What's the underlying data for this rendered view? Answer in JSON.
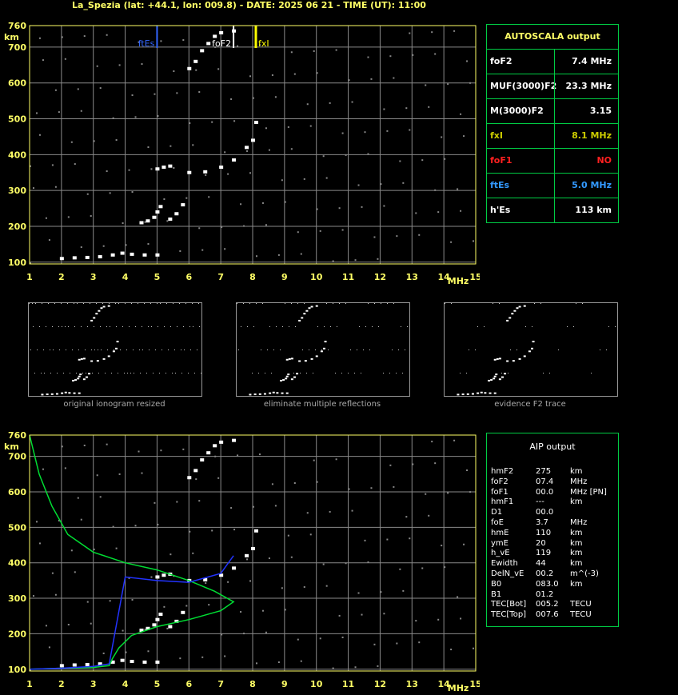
{
  "title": "La_Spezia (lat: +44.1, lon: 009.8) - DATE: 2025 06 21 - TIME (UT): 11:00",
  "colors": {
    "grid": "#8a8a8a",
    "axis": "#ffff66",
    "border": "#00cc44",
    "fxI": "#ffff00",
    "ftEs": "#3366ff",
    "foF1": "#ff2020",
    "profile": "#00dd33",
    "trace": "#2233ff"
  },
  "axes": {
    "y_unit": "km",
    "x_unit": "MHz",
    "y_ticks": [
      "760",
      "700",
      "600",
      "500",
      "400",
      "300",
      "200",
      "100"
    ],
    "x_ticks": [
      "1",
      "2",
      "3",
      "4",
      "5",
      "6",
      "7",
      "8",
      "9",
      "10",
      "11",
      "12",
      "13",
      "14",
      "15"
    ]
  },
  "markers": {
    "ftEs_label": "ftEs",
    "foF2_label": "foF2",
    "fxI_label": "fxI"
  },
  "autoscala": {
    "header": "AUTOSCALA output",
    "rows": [
      {
        "key": "foF2",
        "value": "7.4 MHz",
        "color": "#ffffff"
      },
      {
        "key": "MUF(3000)F2",
        "value": "23.3 MHz",
        "color": "#ffffff"
      },
      {
        "key": "M(3000)F2",
        "value": "3.15",
        "color": "#ffffff"
      },
      {
        "key": "fxI",
        "value": "8.1 MHz",
        "color": "#cccc00"
      },
      {
        "key": "foF1",
        "value": "NO",
        "color": "#ff2020"
      },
      {
        "key": "ftEs",
        "value": "5.0 MHz",
        "color": "#3399ff"
      },
      {
        "key": "h'Es",
        "value": "113    km",
        "color": "#ffffff"
      }
    ]
  },
  "thumbnails": {
    "captions": [
      "original ionogram resized",
      "eliminate multiple reflections",
      "evidence F2 trace"
    ]
  },
  "aip": {
    "header": "AIP output",
    "rows": [
      {
        "k": "hmF2",
        "v": "275",
        "u": "km"
      },
      {
        "k": "foF2",
        "v": "07.4",
        "u": "MHz"
      },
      {
        "k": "foF1",
        "v": "00.0",
        "u": "MHz   [PN]"
      },
      {
        "k": "hmF1",
        "v": "---",
        "u": "km"
      },
      {
        "k": "D1",
        "v": "00.0",
        "u": ""
      },
      {
        "k": "foE",
        "v": "3.7",
        "u": "MHz"
      },
      {
        "k": "hmE",
        "v": "110",
        "u": "km"
      },
      {
        "k": "ymE",
        "v": "20",
        "u": "km"
      },
      {
        "k": "h_vE",
        "v": "119",
        "u": "km"
      },
      {
        "k": "Ewidth",
        "v": "44",
        "u": "km"
      },
      {
        "k": "DelN_vE",
        "v": "00.2",
        "u": "m^(-3)"
      },
      {
        "k": "B0",
        "v": "083.0",
        "u": "km"
      },
      {
        "k": "B1",
        "v": "01.2",
        "u": ""
      },
      {
        "k": "TEC[Bot]",
        "v": "005.2",
        "u": "TECU"
      },
      {
        "k": "TEC[Top]",
        "v": "007.6",
        "u": "TECU"
      }
    ]
  },
  "chart_data": [
    {
      "type": "scatter",
      "title": "",
      "xlabel": "MHz",
      "ylabel": "km",
      "xlim": [
        1,
        15
      ],
      "ylim": [
        95,
        760
      ],
      "series": [
        {
          "name": "",
          "points": [
            [
              2.0,
              110
            ],
            [
              2.4,
              112
            ],
            [
              2.8,
              113
            ],
            [
              3.2,
              115
            ],
            [
              3.6,
              120
            ],
            [
              3.9,
              125
            ],
            [
              4.2,
              122
            ],
            [
              4.6,
              120
            ],
            [
              5.0,
              120
            ],
            [
              4.5,
              210
            ],
            [
              4.7,
              215
            ],
            [
              4.9,
              225
            ],
            [
              5.0,
              240
            ],
            [
              5.1,
              255
            ],
            [
              5.4,
              220
            ],
            [
              5.6,
              235
            ],
            [
              5.8,
              260
            ],
            [
              5.0,
              360
            ],
            [
              5.2,
              365
            ],
            [
              5.4,
              368
            ],
            [
              6.0,
              350
            ],
            [
              6.5,
              352
            ],
            [
              7.0,
              365
            ],
            [
              7.4,
              385
            ],
            [
              7.8,
              420
            ],
            [
              8.0,
              440
            ],
            [
              8.1,
              490
            ],
            [
              6.0,
              640
            ],
            [
              6.2,
              660
            ],
            [
              6.4,
              690
            ],
            [
              6.6,
              710
            ],
            [
              6.8,
              730
            ],
            [
              7.0,
              740
            ],
            [
              7.4,
              745
            ]
          ]
        }
      ]
    },
    {
      "type": "line",
      "title": "",
      "xlabel": "MHz",
      "ylabel": "km",
      "xlim": [
        1,
        15
      ],
      "ylim": [
        95,
        760
      ],
      "series": [
        {
          "name": "",
          "points": [
            [
              1.0,
              760
            ],
            [
              1.3,
              650
            ],
            [
              1.7,
              560
            ],
            [
              2.2,
              480
            ],
            [
              3.0,
              430
            ],
            [
              4.0,
              400
            ],
            [
              5.0,
              380
            ],
            [
              6.0,
              350
            ],
            [
              6.8,
              320
            ],
            [
              7.4,
              290
            ],
            [
              7.0,
              265
            ],
            [
              6.0,
              240
            ],
            [
              5.0,
              220
            ],
            [
              4.2,
              195
            ],
            [
              3.8,
              160
            ],
            [
              3.6,
              130
            ],
            [
              3.5,
              110
            ],
            [
              3.0,
              105
            ],
            [
              2.0,
              103
            ],
            [
              1.0,
              100
            ]
          ]
        },
        {
          "name": "",
          "points": [
            [
              1.0,
              100
            ],
            [
              2.0,
              103
            ],
            [
              3.0,
              108
            ],
            [
              3.5,
              115
            ],
            [
              4.0,
              360
            ],
            [
              5.0,
              350
            ],
            [
              6.0,
              345
            ],
            [
              7.0,
              370
            ],
            [
              7.4,
              420
            ]
          ]
        }
      ]
    }
  ]
}
